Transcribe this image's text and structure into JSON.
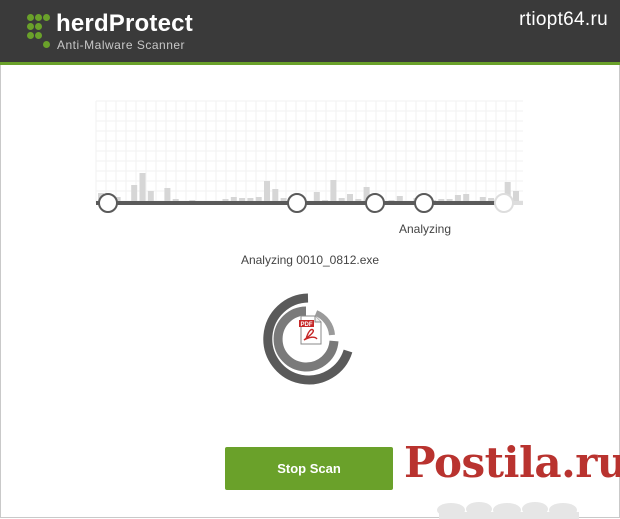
{
  "header": {
    "brand": "herdProtect",
    "tagline": "Anti-Malware Scanner",
    "accent_color": "#6aa12a"
  },
  "watermark": "rtiopt64.ru",
  "scan": {
    "status": "Analyzing",
    "current_file": "Analyzing 0010_0812.exe"
  },
  "file_icon": {
    "name": "pdf-file-icon",
    "label": "PDF"
  },
  "stop_button": {
    "label": "Stop Scan"
  },
  "postila": "Postila.ru"
}
